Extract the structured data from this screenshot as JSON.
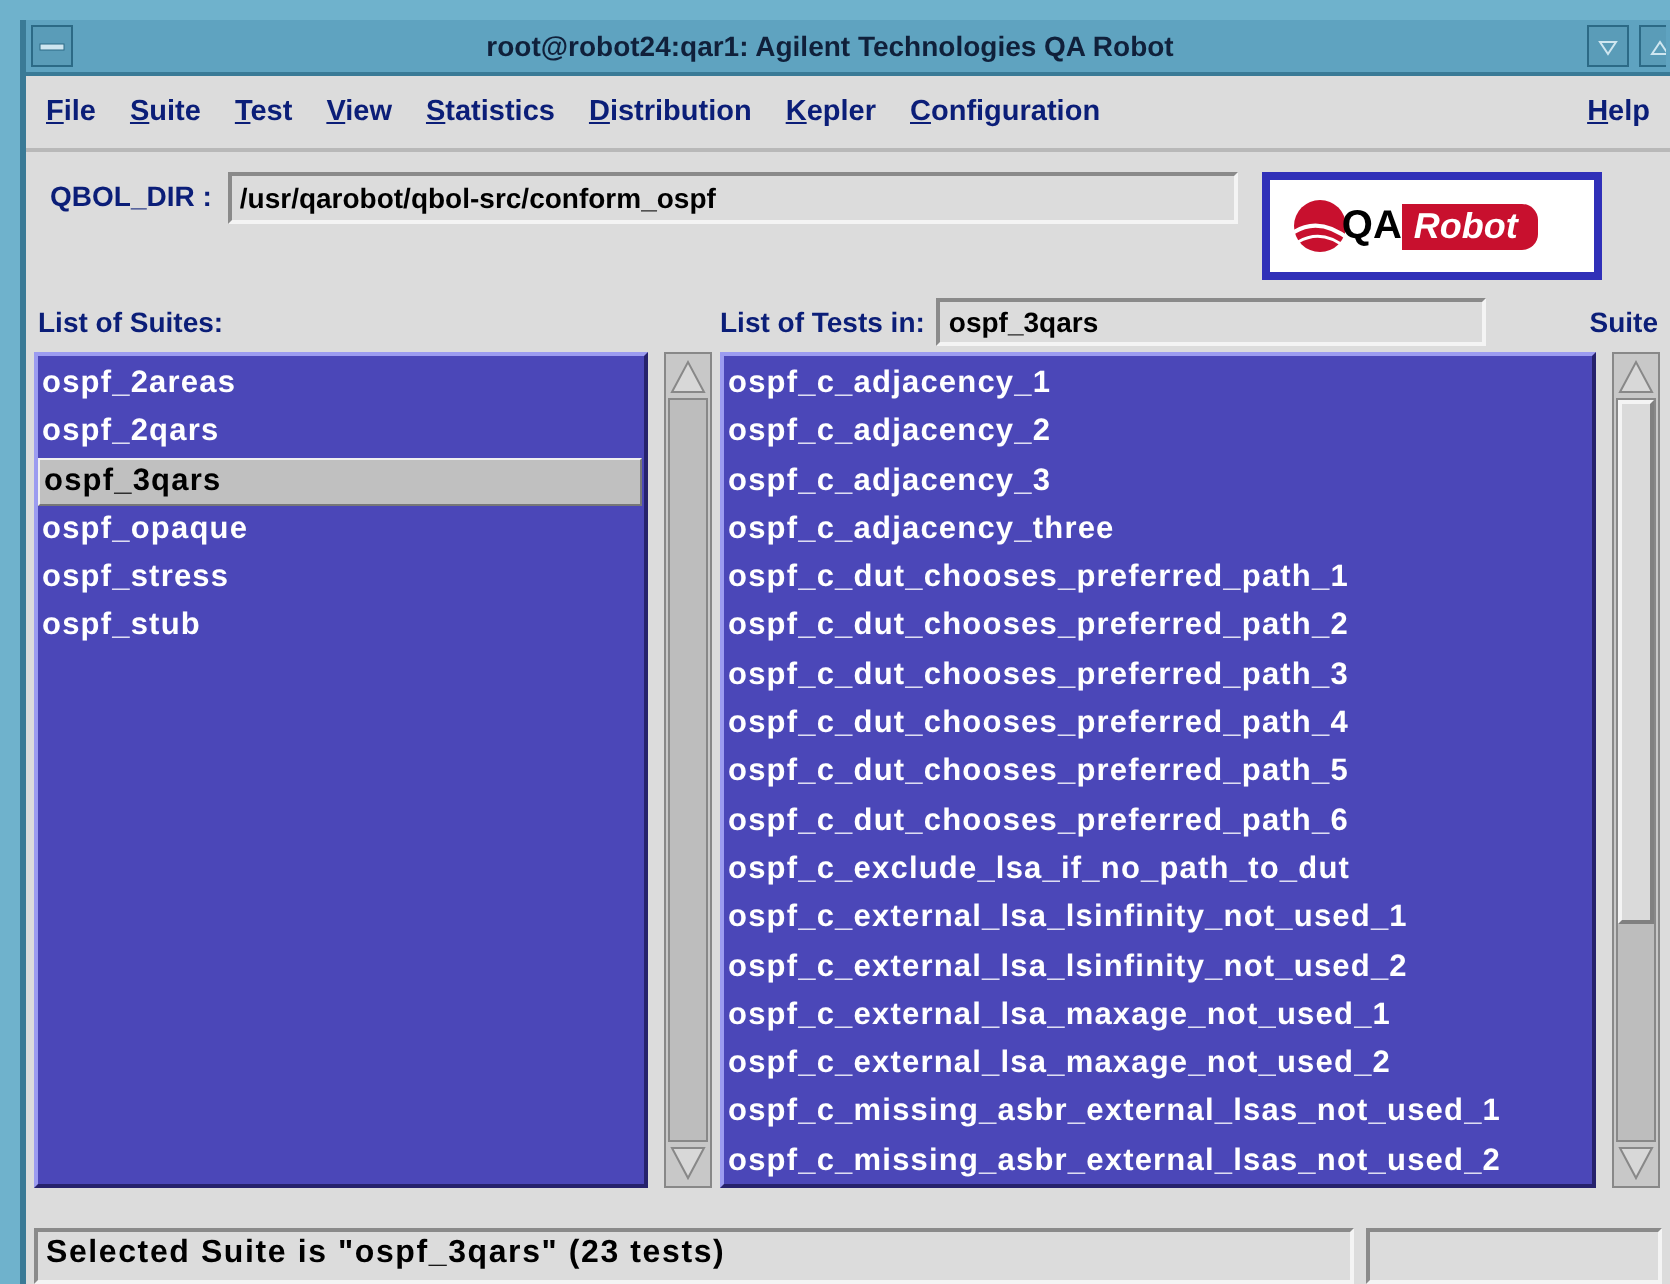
{
  "window": {
    "title": "root@robot24:qar1: Agilent Technologies QA Robot"
  },
  "menu": [
    {
      "label": "File"
    },
    {
      "label": "Suite"
    },
    {
      "label": "Test"
    },
    {
      "label": "View"
    },
    {
      "label": "Statistics"
    },
    {
      "label": "Distribution"
    },
    {
      "label": "Kepler"
    },
    {
      "label": "Configuration"
    },
    {
      "label": "Help"
    }
  ],
  "qbol_dir": {
    "label": "QBOL_DIR :",
    "value": "/usr/qarobot/qbol-src/conform_ospf"
  },
  "logo": {
    "text_left": "QA",
    "text_right": "Robot"
  },
  "suites": {
    "label": "List of Suites:",
    "items": [
      {
        "name": "ospf_2areas",
        "selected": false
      },
      {
        "name": "ospf_2qars",
        "selected": false
      },
      {
        "name": "ospf_3qars",
        "selected": true
      },
      {
        "name": "ospf_opaque",
        "selected": false
      },
      {
        "name": "ospf_stress",
        "selected": false
      },
      {
        "name": "ospf_stub",
        "selected": false
      }
    ]
  },
  "tests": {
    "label": "List of Tests in:",
    "suite": "ospf_3qars",
    "items": [
      "ospf_c_adjacency_1",
      "ospf_c_adjacency_2",
      "ospf_c_adjacency_3",
      "ospf_c_adjacency_three",
      "ospf_c_dut_chooses_preferred_path_1",
      "ospf_c_dut_chooses_preferred_path_2",
      "ospf_c_dut_chooses_preferred_path_3",
      "ospf_c_dut_chooses_preferred_path_4",
      "ospf_c_dut_chooses_preferred_path_5",
      "ospf_c_dut_chooses_preferred_path_6",
      "ospf_c_exclude_lsa_if_no_path_to_dut",
      "ospf_c_external_lsa_lsinfinity_not_used_1",
      "ospf_c_external_lsa_lsinfinity_not_used_2",
      "ospf_c_external_lsa_maxage_not_used_1",
      "ospf_c_external_lsa_maxage_not_used_2",
      "ospf_c_missing_asbr_external_lsas_not_used_1",
      "ospf_c_missing_asbr_external_lsas_not_used_2"
    ]
  },
  "suite_column": {
    "label": "Suite"
  },
  "status_bar": {
    "text": "Selected Suite is \"ospf_3qars\" (23 tests)"
  }
}
